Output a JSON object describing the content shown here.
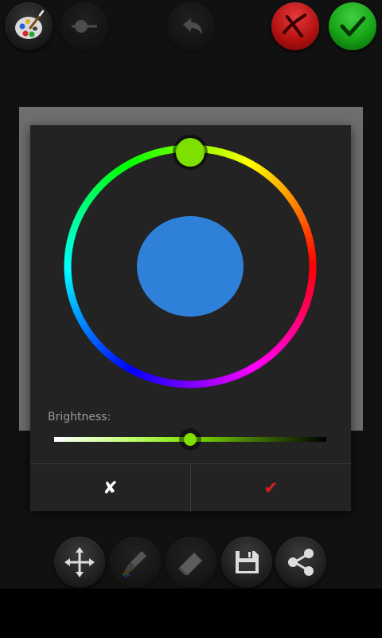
{
  "toolbar_top": {
    "palette": {
      "icon": "palette-icon"
    },
    "brush_size": {
      "icon": "brush-size-icon"
    },
    "undo": {
      "icon": "undo-icon"
    },
    "discard": {
      "icon": "close-icon",
      "color": "#c01818"
    },
    "accept": {
      "icon": "check-icon",
      "color": "#18a818"
    }
  },
  "dialog": {
    "selected_color": "#2f80d8",
    "hue_thumb_color": "#7fe000",
    "brightness_label": "Brightness:",
    "brightness_value": 0.5,
    "cancel_label": "✘",
    "ok_label": "✔"
  },
  "toolbar_bottom": {
    "move": {
      "icon": "move-icon"
    },
    "brush": {
      "icon": "brush-icon"
    },
    "eraser": {
      "icon": "eraser-icon"
    },
    "save": {
      "icon": "save-icon"
    },
    "share": {
      "icon": "share-icon"
    }
  }
}
